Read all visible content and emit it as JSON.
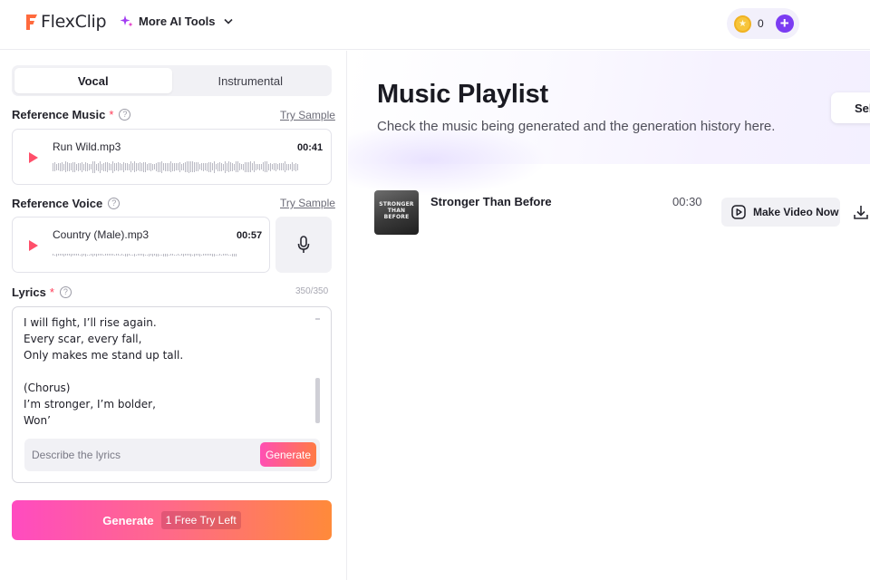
{
  "header": {
    "logo_text": "FlexClip",
    "ai_tools_label": "More AI Tools",
    "credits": "0",
    "plus_label": "+"
  },
  "left": {
    "tabs": [
      {
        "label": "Vocal",
        "active": true
      },
      {
        "label": "Instrumental",
        "active": false
      }
    ],
    "reference_music": {
      "label": "Reference Music",
      "required_mark": "*",
      "help": "?",
      "try_sample": "Try Sample",
      "file_name": "Run Wild.mp3",
      "duration": "00:41"
    },
    "reference_voice": {
      "label": "Reference Voice",
      "help": "?",
      "try_sample": "Try Sample",
      "file_name": "Country (Male).mp3",
      "duration": "00:57"
    },
    "lyrics": {
      "label": "Lyrics",
      "required_mark": "*",
      "help": "?",
      "counter": "350/350",
      "lines": [
        "I will fight, I’ll rise again.",
        "Every scar, every fall,",
        "Only makes me stand up tall.",
        "",
        "(Chorus)",
        "I’m stronger, I’m bolder,",
        "Won’"
      ],
      "describe_placeholder": "Describe the lyrics",
      "generate_label": "Generate"
    },
    "generate_button": {
      "label": "Generate",
      "badge": "1 Free Try Left"
    }
  },
  "right": {
    "title": "Music Playlist",
    "subtitle": "Check the music being generated and the generation history here.",
    "select_label": "Sel",
    "tracks": [
      {
        "title": "Stronger Than Before",
        "duration": "00:30",
        "thumbnail_text": "STRONGER THAN BEFORE",
        "make_video_label": "Make Video Now"
      }
    ]
  },
  "colors": {
    "brand_orange": "#ff6a3d",
    "accent_purple": "#7b3cf2",
    "play_pink": "#ff4f6a",
    "gradient_start": "#ff4bc0",
    "gradient_end": "#ff8a3a",
    "required_red": "#ff3b57"
  },
  "icons": {
    "sparkle": "sparkle-icon",
    "chevron": "chevron-down-icon",
    "coin": "coin-icon",
    "play": "play-icon",
    "mic": "microphone-icon",
    "video": "video-play-icon",
    "download": "download-icon"
  }
}
